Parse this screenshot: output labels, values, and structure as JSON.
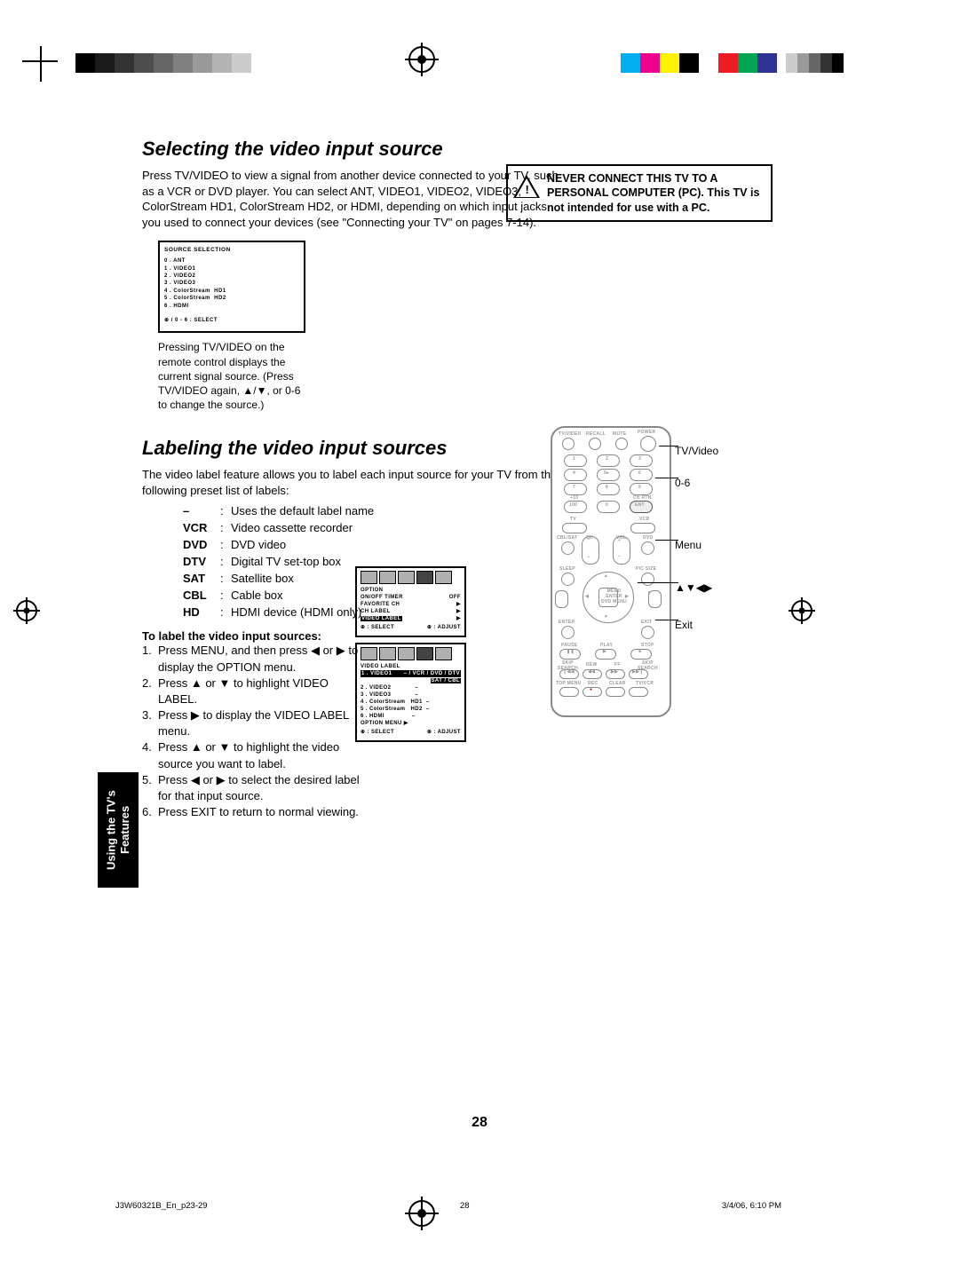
{
  "regbar_greys": [
    "#000000",
    "#1a1a1a",
    "#333333",
    "#4d4d4d",
    "#666666",
    "#808080",
    "#999999",
    "#b3b3b3",
    "#cccccc",
    "#ffffff"
  ],
  "regbar_colors": [
    "#00aeef",
    "#ec008c",
    "#fff200",
    "#000000",
    "#ffffff",
    "#ed1c24",
    "#00a651",
    "#2e3192"
  ],
  "dup_colors": [
    "#cccccc",
    "#999999",
    "#666666",
    "#333333",
    "#000000"
  ],
  "section1_title": "Selecting the video input source",
  "section1_body": "Press TV/VIDEO to view a signal from another device connected to your TV, such as a VCR or DVD player. You can select ANT, VIDEO1, VIDEO2, VIDEO3, ColorStream HD1, ColorStream HD2, or HDMI, depending on which input jacks you used to connect your devices (see \"Connecting your TV\" on pages 7-14).",
  "warn_l1": "NEVER CONNECT THIS TV TO A PERSONAL COMPUTER (PC).",
  "warn_l2": "This TV is not intended for use with a PC.",
  "osd1_title": "SOURCE SELECTION",
  "osd1_rows": [
    "0 . ANT",
    "1 . VIDEO1",
    "2 . VIDEO2",
    "3 . VIDEO3",
    "4 . ColorStream  HD1",
    "5 . ColorStream  HD2",
    "6 . HDMI"
  ],
  "osd1_footer": "⊕ / 0 - 6 : SELECT",
  "osd1_caption": "Pressing TV/VIDEO on the remote control displays the current signal source. (Press TV/VIDEO again, ▲/▼, or 0-6 to change the source.)",
  "section2_title": "Labeling the video input sources",
  "section2_intro": "The video label feature allows you to label each input source for your TV from the following preset list of labels:",
  "labels": [
    {
      "k": "–",
      "v": "Uses the default label name"
    },
    {
      "k": "VCR",
      "v": "Video cassette recorder"
    },
    {
      "k": "DVD",
      "v": "DVD video"
    },
    {
      "k": "DTV",
      "v": "Digital TV set-top box"
    },
    {
      "k": "SAT",
      "v": "Satellite box"
    },
    {
      "k": "CBL",
      "v": "Cable box"
    },
    {
      "k": "HD",
      "v": "HDMI device (HDMI only)"
    }
  ],
  "steps_title": "To label the video input sources:",
  "steps": [
    "Press MENU, and then press ◀ or ▶ to display the OPTION menu.",
    "Press ▲ or ▼ to highlight VIDEO LABEL.",
    "Press ▶ to display the VIDEO LABEL menu.",
    "Press ▲ or ▼ to highlight the video source you want to label.",
    "Press ◀ or ▶ to select the desired label for that input source.",
    "Press EXIT to return to normal viewing."
  ],
  "osd2a_title": "OPTION",
  "osd2a_rows": [
    {
      "l": "ON/OFF TIMER",
      "r": "OFF"
    },
    {
      "l": "FAVORITE CH",
      "r": "▶"
    },
    {
      "l": "CH LABEL",
      "r": "▶"
    }
  ],
  "osd2a_hl": "VIDEO LABEL",
  "osd2a_hl_r": "▶",
  "osd2a_fl": "⊕ : SELECT",
  "osd2a_fr": "⊕ : ADJUST",
  "osd2b_title": "VIDEO LABEL",
  "osd2b_hl_l": "1 . VIDEO1",
  "osd2b_hl_r": "– / VCR / DVD / DTV",
  "osd2b_hl_r2": "SAT / CBL",
  "osd2b_rows": [
    "2 . VIDEO2             –",
    "3 . VIDEO3             –",
    "4 . ColorStream   HD1  –",
    "5 . ColorStream   HD2  –",
    "6 . HDMI               –"
  ],
  "osd2b_menu": "OPTION MENU        ▶",
  "osd2b_fl": "⊕ : SELECT",
  "osd2b_fr": "⊕ : ADJUST",
  "remote_l1": "TV/Video",
  "remote_l2": "0-6",
  "remote_l3": "Menu",
  "remote_l4": "▲▼◀▶",
  "remote_l5": "Exit",
  "side_tab": "Using the TV's\nFeatures",
  "page_number": "28",
  "footer_left": "J3W60321B_En_p23-29",
  "footer_mid": "28",
  "footer_right": "3/4/06, 6:10 PM"
}
